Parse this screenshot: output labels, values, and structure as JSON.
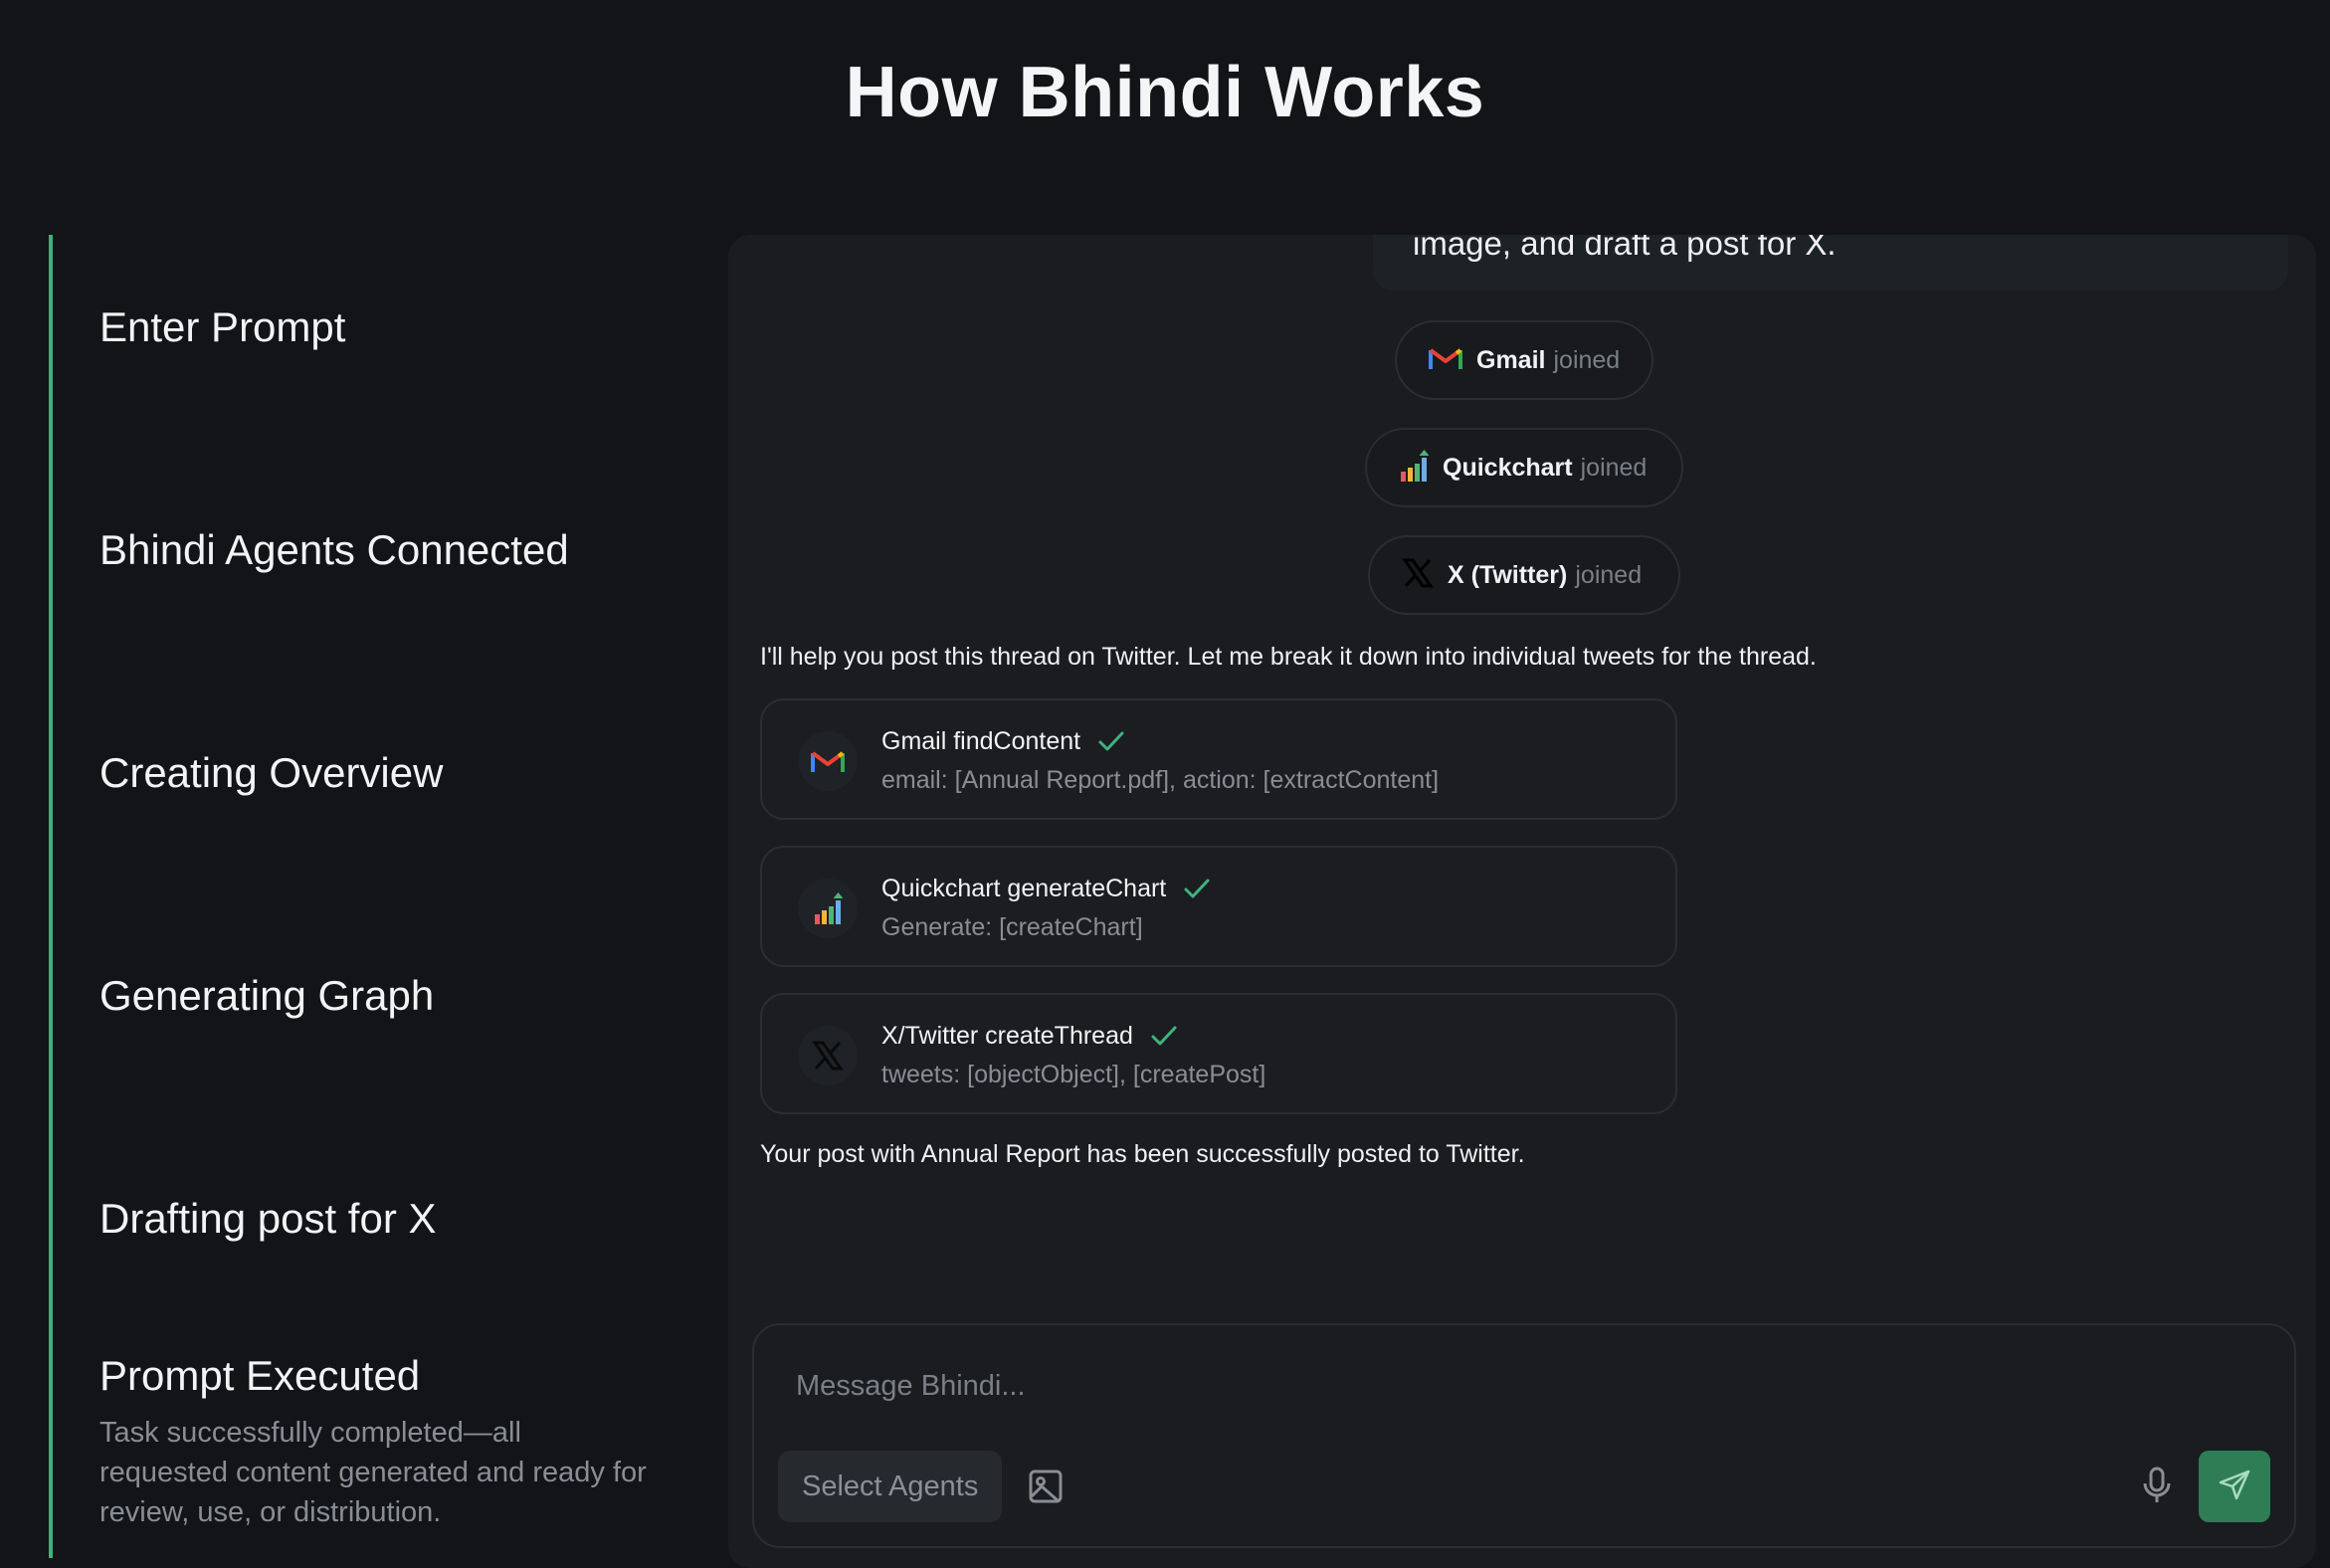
{
  "page": {
    "title": "How Bhindi Works"
  },
  "timeline": {
    "accent_color": "#3fb37c",
    "steps": [
      {
        "title": "Enter Prompt"
      },
      {
        "title": "Bhindi Agents Connected"
      },
      {
        "title": "Creating Overview"
      },
      {
        "title": "Generating Graph"
      },
      {
        "title": "Drafting post for X"
      },
      {
        "title": "Prompt Executed",
        "description": "Task successfully completed—all requested content generated and ready for review, use, or distribution."
      }
    ]
  },
  "chat": {
    "prompt_tail": "image, and draft a post for X.",
    "joined_label": "joined",
    "agents_joined": [
      {
        "name": "Gmail",
        "icon": "gmail-icon"
      },
      {
        "name": "Quickchart",
        "icon": "quickchart-icon"
      },
      {
        "name": "X (Twitter)",
        "icon": "x-icon"
      }
    ],
    "assistant_intro": "I'll help you post this thread on Twitter. Let me break it down into individual tweets for the thread.",
    "tool_calls": [
      {
        "title": "Gmail findContent",
        "args": "email: [Annual Report.pdf], action: [extractContent]",
        "icon": "gmail-icon",
        "status": "done"
      },
      {
        "title": "Quickchart generateChart",
        "args": "Generate: [createChart]",
        "icon": "quickchart-icon",
        "status": "done"
      },
      {
        "title": "X/Twitter createThread",
        "args": "tweets: [objectObject], [createPost]",
        "icon": "x-icon",
        "status": "done"
      }
    ],
    "assistant_result": "Your post with Annual Report has been successfully posted to Twitter."
  },
  "composer": {
    "placeholder": "Message Bhindi...",
    "select_agents_label": "Select Agents",
    "send_color": "#2e7d55"
  }
}
